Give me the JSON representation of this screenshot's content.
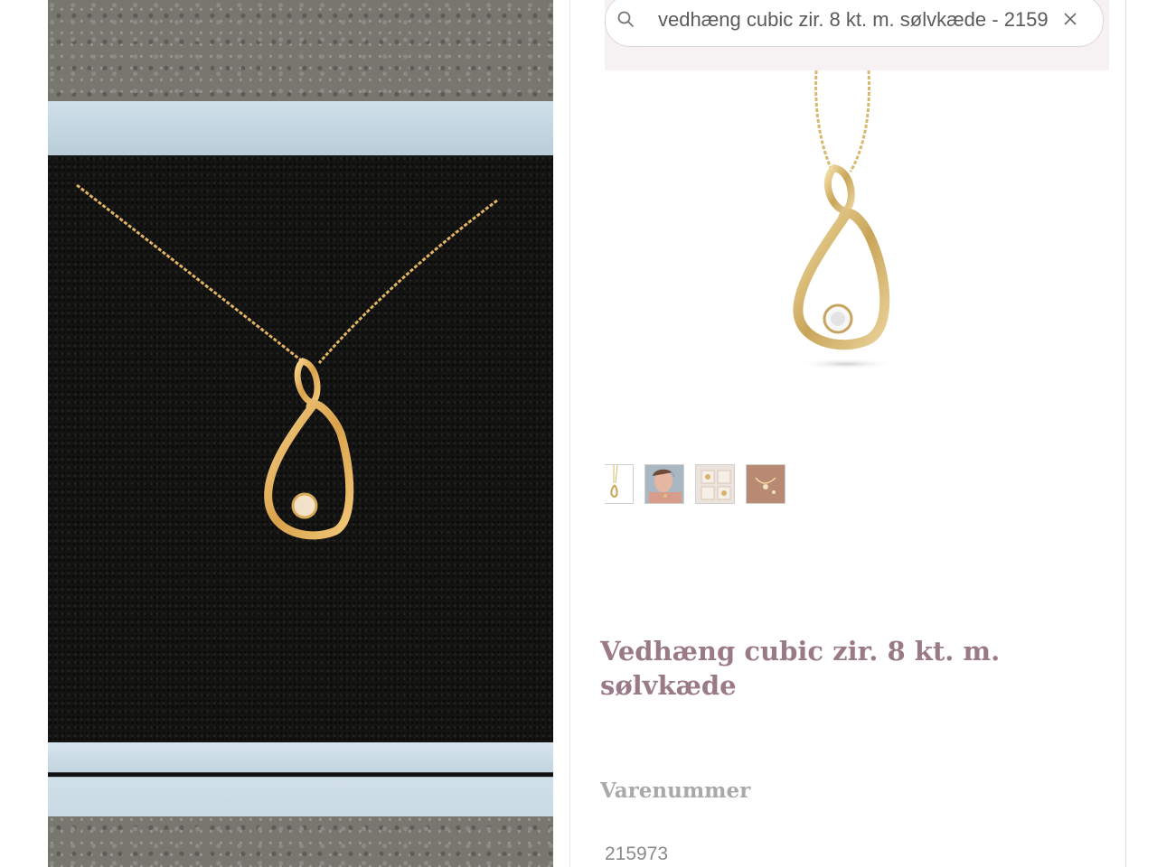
{
  "search": {
    "value": "vedhæng cubic zir. 8 kt. m. sølvkæde - 2159",
    "search_icon": "search-icon",
    "clear_icon": "close-icon"
  },
  "product": {
    "title": "Vedhæng cubic zir. 8 kt. m. sølvkæde",
    "sku_label": "Varenummer",
    "sku_value": "215973"
  },
  "gallery": {
    "thumbnail_count": 4,
    "thumbnails": [
      "pendant-thumbnail",
      "model-thumbnail",
      "jewelry-box-thumbnail",
      "lifestyle-thumbnail"
    ]
  },
  "colors": {
    "title": "#9a7a87",
    "gold": "#d9b46a"
  }
}
